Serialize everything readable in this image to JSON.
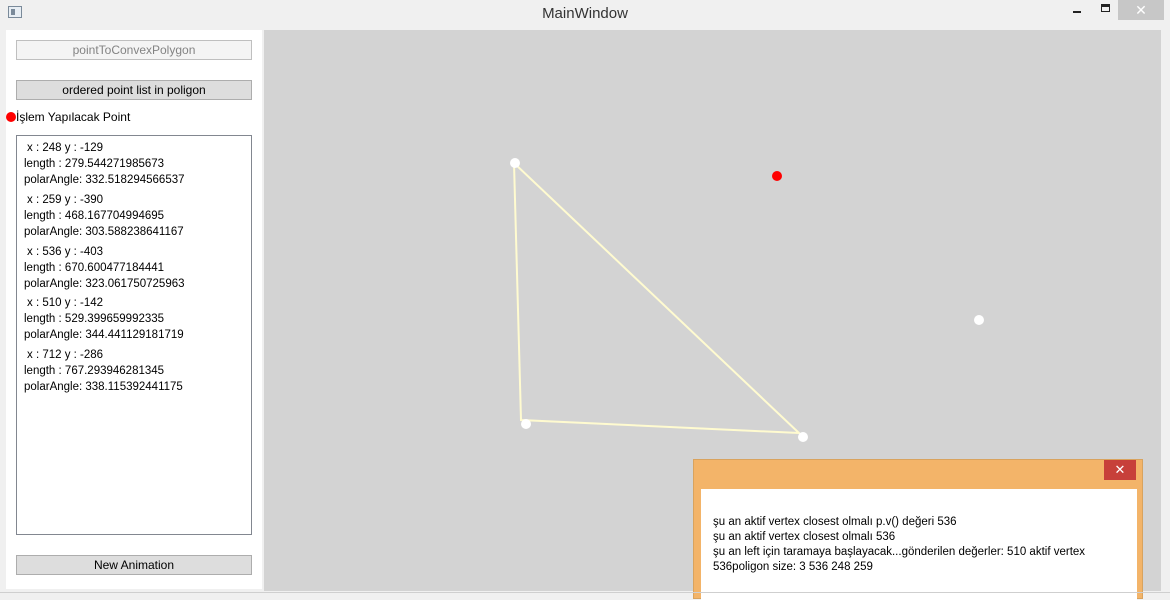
{
  "window": {
    "title": "MainWindow",
    "close_label": "✕"
  },
  "sidebar": {
    "btn_convex": "pointToConvexPolygon",
    "btn_ordered": "ordered point list in poligon",
    "point_label": "İşlem Yapılacak Point",
    "btn_new_animation": "New Animation",
    "entries": [
      {
        "coords": "x : 248 y : -129",
        "length": "length : 279.544271985673",
        "polar": "polarAngle: 332.518294566537"
      },
      {
        "coords": "x : 259 y : -390",
        "length": "length : 468.167704994695",
        "polar": "polarAngle: 303.588238641167"
      },
      {
        "coords": "x : 536 y : -403",
        "length": "length : 670.600477184441",
        "polar": "polarAngle: 323.061750725963"
      },
      {
        "coords": "x : 510 y : -142",
        "length": "length : 529.399659992335",
        "polar": "polarAngle: 344.441129181719"
      },
      {
        "coords": "x : 712 y : -286",
        "length": "length : 767.293946281345",
        "polar": "polarAngle: 338.115392441175"
      }
    ]
  },
  "colors": {
    "active_point": "#ff0000",
    "polygon_edge": "#fffbd0",
    "point": "#ffffff",
    "canvas": "#d3d3d3",
    "dialog_frame": "#f3b469"
  },
  "dialog": {
    "close_label": "✕",
    "lines": [
      "şu an aktif vertex closest olmalı p.v() değeri  536",
      "şu an aktif vertex closest olmalı 536",
      " şu an left için taramaya başlayacak...gönderilen değerler: 510 aktif vertex",
      "536poligon size:  3  536 248 259"
    ]
  }
}
